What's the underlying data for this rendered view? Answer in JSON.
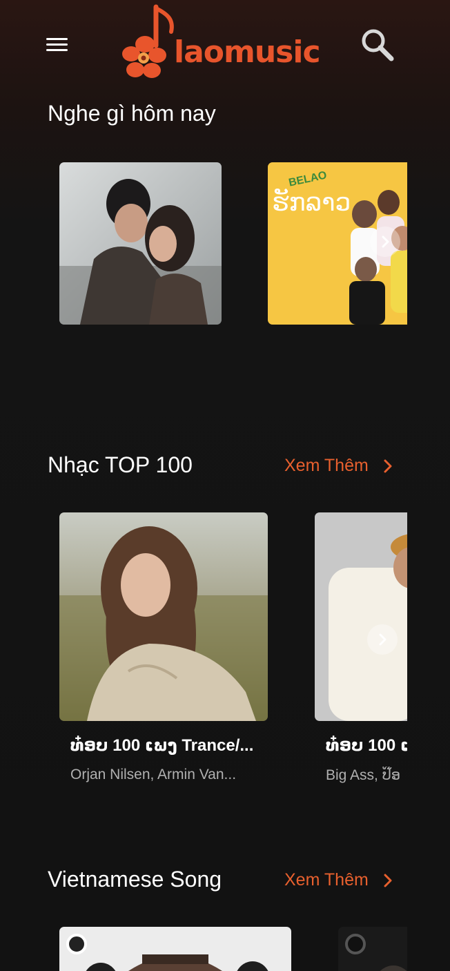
{
  "header": {
    "logo_text": "laomusic",
    "menu_icon": "hamburger-menu-icon",
    "search_icon": "search-icon"
  },
  "colors": {
    "brand": "#e8552c",
    "background": "#141414",
    "see_more": "#e8602e"
  },
  "sections": {
    "today": {
      "title": "Nghe gì hôm nay"
    },
    "top100": {
      "title": "Nhạc TOP 100",
      "see_more": "Xem Thêm",
      "cards": [
        {
          "title": "ທ໋ອບ 100 ເພງ Trance/...",
          "subtitle": "Orjan Nilsen, Armin Van..."
        },
        {
          "title": "ທ໋ອບ 100 ເ",
          "subtitle": "Big Ass, ປ໊ອ"
        }
      ]
    },
    "vietnamese": {
      "title": "Vietnamese Song",
      "see_more": "Xem Thêm"
    }
  },
  "banner_text": {
    "belao": "BELAO",
    "lao_script": "ຮັກລາວ"
  }
}
